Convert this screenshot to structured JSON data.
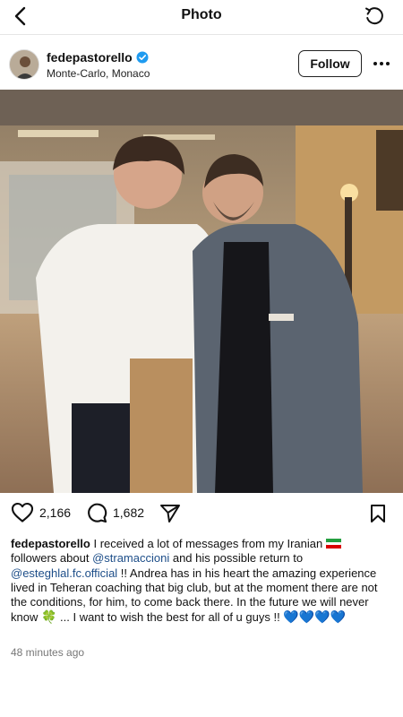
{
  "topbar": {
    "title": "Photo",
    "back_icon": "chevron-left-icon",
    "refresh_icon": "refresh-icon"
  },
  "post": {
    "username": "fedepastorello",
    "verified": true,
    "location": "Monte-Carlo, Monaco",
    "follow_label": "Follow",
    "likes": "2,166",
    "comments": "1,682",
    "caption": {
      "username": "fedepastorello",
      "part1": " I received a lot of messages from my Iranian ",
      "part2": " followers about ",
      "mention1": "@stramaccioni",
      "part3": " and his possible return to ",
      "mention2": "@esteghlal.fc.official",
      "part4": " !! Andrea has in his heart the amazing experience lived in Teheran coaching that big club, but at the moment there are not the conditions, for him, to come back there. In the future we will never know ",
      "clover": "🍀",
      "part5": " ... I want to wish the best for all of u guys !! ",
      "hearts": "💙💙💙💙"
    },
    "timestamp": "48 minutes ago"
  },
  "colors": {
    "verified_blue": "#1f9bf0",
    "mention": "#1d4e89",
    "heart_blue": "#1e8af0"
  }
}
